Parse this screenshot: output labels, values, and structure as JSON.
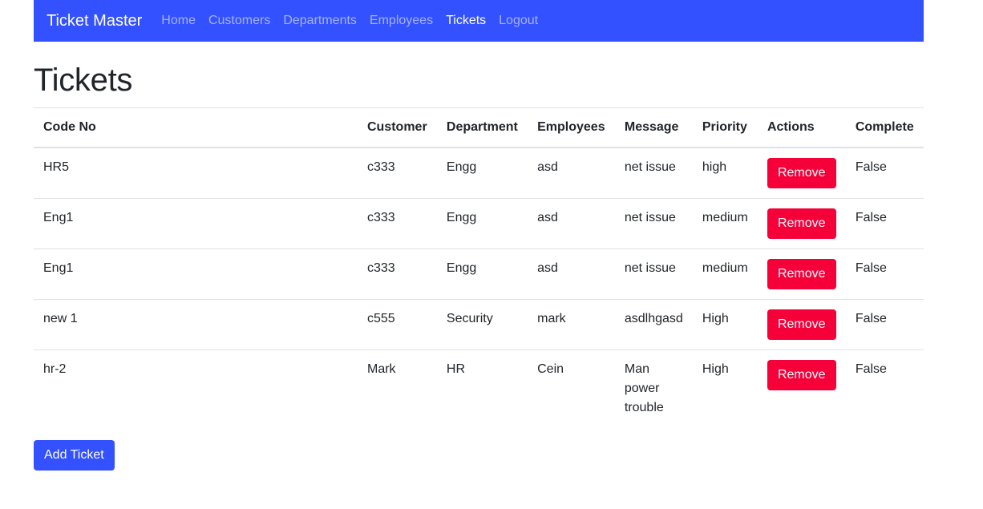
{
  "navbar": {
    "brand": "Ticket Master",
    "links": [
      "Home",
      "Customers",
      "Departments",
      "Employees",
      "Tickets",
      "Logout"
    ],
    "active": "Tickets",
    "color": "#3351ff"
  },
  "page": {
    "title": "Tickets"
  },
  "table": {
    "headers": [
      "Code No",
      "Customer",
      "Department",
      "Employees",
      "Message",
      "Priority",
      "Actions",
      "Complete"
    ],
    "rows": [
      {
        "code": "HR5",
        "customer": "c333",
        "department": "Engg",
        "employees": "asd",
        "message": "net issue",
        "priority": "high",
        "action": "Remove",
        "complete": "False"
      },
      {
        "code": "Eng1",
        "customer": "c333",
        "department": "Engg",
        "employees": "asd",
        "message": "net issue",
        "priority": "medium",
        "action": "Remove",
        "complete": "False"
      },
      {
        "code": "Eng1",
        "customer": "c333",
        "department": "Engg",
        "employees": "asd",
        "message": "net issue",
        "priority": "medium",
        "action": "Remove",
        "complete": "False"
      },
      {
        "code": "new 1",
        "customer": "c555",
        "department": "Security",
        "employees": "mark",
        "message": "asdlhgasd",
        "priority": "High",
        "action": "Remove",
        "complete": "False"
      },
      {
        "code": "hr-2",
        "customer": "Mark",
        "department": "HR",
        "employees": "Cein",
        "message": "Man power trouble",
        "priority": "High",
        "action": "Remove",
        "complete": "False"
      }
    ]
  },
  "actions": {
    "add_ticket_label": "Add Ticket"
  },
  "colors": {
    "primary": "#3351ff",
    "danger": "#f50039"
  }
}
